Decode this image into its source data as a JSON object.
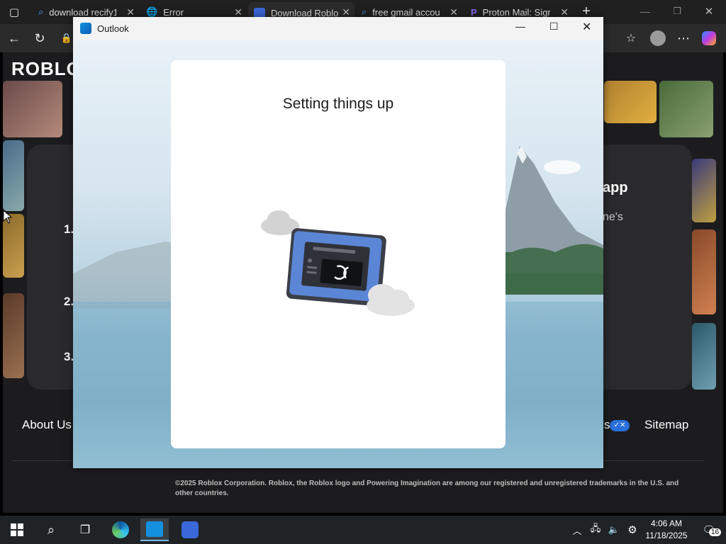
{
  "browser": {
    "tabs": [
      {
        "label": "download recify1",
        "icon": "search-icon"
      },
      {
        "label": "Error",
        "icon": "globe-icon"
      },
      {
        "label": "Download Roblox",
        "icon": "roblox-icon"
      },
      {
        "label": "free gmail accou",
        "icon": "search-icon"
      },
      {
        "label": "Proton Mail: Sign",
        "icon": "proton-icon"
      }
    ]
  },
  "page": {
    "brand": "ROBLOX",
    "card_heading_fragment": "app",
    "card_sub_fragment": "ne's",
    "steps": [
      "1.",
      "2.",
      "3."
    ],
    "footer_links": [
      "About Us",
      "Sitemap"
    ],
    "footer_fragment": "s",
    "copyright": "©2025 Roblox Corporation. Roblox, the Roblox logo and Powering Imagination are among our registered and unregistered trademarks in the U.S. and other countries."
  },
  "outlook": {
    "title": "Outlook",
    "heading": "Setting things up"
  },
  "taskbar": {
    "time": "4:06 AM",
    "date": "11/18/2025",
    "notification_count": "16"
  },
  "colors": {
    "accent": "#0078d4",
    "device_blue": "#5b86d6"
  }
}
